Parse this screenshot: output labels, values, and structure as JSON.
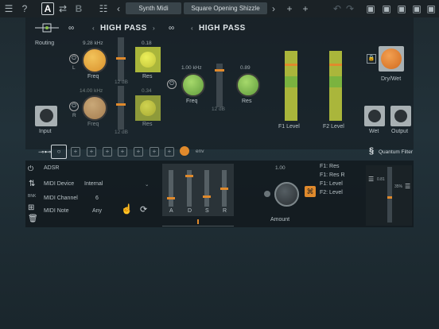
{
  "toolbar": {
    "menu_icon": "menu-icon",
    "help": "?",
    "preset_a": "A",
    "preset_b": "B",
    "preset_name": "Synth Midi",
    "preset_sub": "Square Opening Shizzle"
  },
  "filter1": {
    "title": "HIGH PASS",
    "freq_value": "9.28 kHz",
    "res_value": "0.18",
    "freq_label": "Freq",
    "res_label": "Res",
    "freq_value2": "14.00 kHz",
    "res_value2": "0.34",
    "freq_label2": "Freq",
    "res_label2": "Res",
    "db": "12 dB",
    "db2": "12 dB"
  },
  "filter2": {
    "title": "HIGH PASS",
    "freq_value": "1.00 kHz",
    "res_value": "0.89",
    "freq_label": "Freq",
    "res_label": "Res",
    "db": "12 dB"
  },
  "labels": {
    "routing": "Routing",
    "input": "Input",
    "f1_level": "F1 Level",
    "f2_level": "F2 Level",
    "dry_wet": "Dry/Wet",
    "wet": "Wet",
    "output": "Output",
    "left": "L",
    "right": "R"
  },
  "strip": {
    "env": "env",
    "brand": "Quantum Filter"
  },
  "midi": {
    "adsr": "ADSR",
    "device_label": "MIDI Device",
    "device_value": "Internal",
    "channel_label": "MIDI Channel",
    "channel_value": "6",
    "note_label": "MIDI Note",
    "note_value": "Any",
    "side": "BNK"
  },
  "adsr": {
    "a": "A",
    "d": "D",
    "s": "S",
    "r": "R",
    "levels": [
      0.25,
      0.75,
      0.2,
      0.45
    ]
  },
  "amount": {
    "value": "1.00",
    "label": "Amount"
  },
  "targets": [
    "F1: Res",
    "F1: Res R",
    "F1: Level",
    "F2: Level"
  ],
  "mini": {
    "left": "0.81",
    "right": "35%"
  },
  "colors": {
    "accent": "#e08a2c",
    "pad": "#aab63b"
  }
}
